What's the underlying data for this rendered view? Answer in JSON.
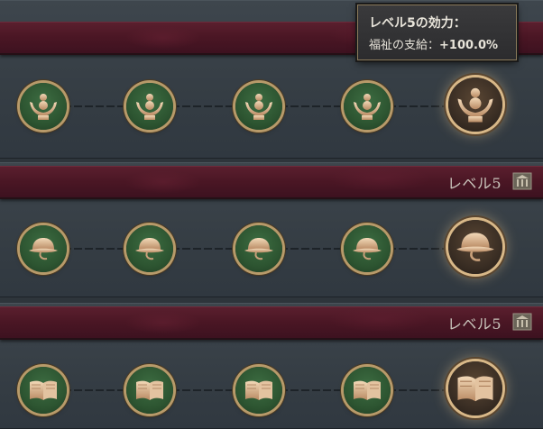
{
  "tooltip": {
    "title": "レベル5の効力：",
    "line_label": "福祉の支給：",
    "line_value": "+100.0%"
  },
  "rows": [
    {
      "icon": "welfare-hands-icon",
      "banner_label": ""
    },
    {
      "icon": "helmet-icon",
      "banner_label": "レベル5"
    },
    {
      "icon": "book-icon",
      "banner_label": "レベル5"
    }
  ],
  "colors": {
    "banner": "#4a1624",
    "node_green": "#2d5531",
    "gold": "#d8b888"
  }
}
